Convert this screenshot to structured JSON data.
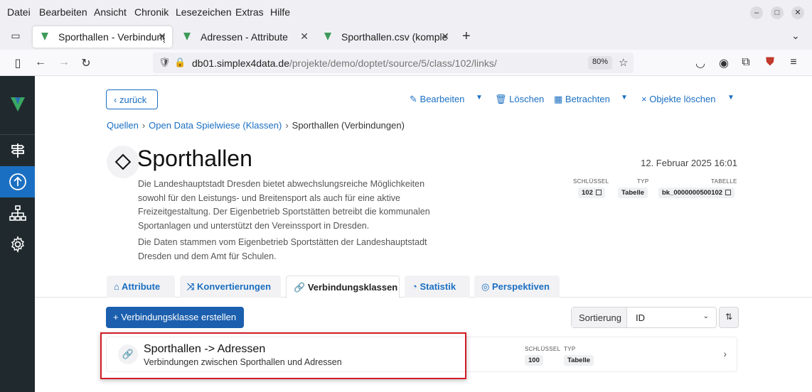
{
  "browser": {
    "menu": [
      "Datei",
      "Bearbeiten",
      "Ansicht",
      "Chronik",
      "Lesezeichen",
      "Extras",
      "Hilfe"
    ],
    "tabs": [
      {
        "label": "Sporthallen - Verbindungsklassen",
        "active": true
      },
      {
        "label": "Adressen - Attribute",
        "active": false
      },
      {
        "label": "Sporthallen.csv (komplett)",
        "active": false
      }
    ],
    "url_domain": "db01.simplex4data.de",
    "url_path": "/projekte/demo/doptet/source/5/class/102/links/",
    "zoom": "80%",
    "favicon_color": "#3d9a5a"
  },
  "sidebar": {
    "items": [
      "routing-icon",
      "upload-icon",
      "sitemap-icon",
      "gear-icon"
    ],
    "active_index": 1,
    "accent": "#1b6fc2"
  },
  "toolbar": {
    "back_label": "zurück",
    "edit_label": "Bearbeiten",
    "delete_label": "Löschen",
    "view_label": "Betrachten",
    "delete_objects_label": "Objekte löschen"
  },
  "breadcrumb": [
    "Quellen",
    "Open Data Spielwiese (Klassen)",
    "Sporthallen (Verbindungen)"
  ],
  "header": {
    "title": "Sporthallen",
    "datetime": "12. Februar 2025 16:01",
    "description_1": "Die Landeshauptstadt Dresden bietet abwechslungsreiche Möglichkeiten sowohl für den Leistungs- und Breitensport als auch für eine aktive Freizeitgestaltung. Der Eigenbetrieb Sportstätten betreibt die kommunalen Sportanlagen und unterstützt den Vereinssport in Dresden.",
    "description_2": "Die Daten stammen vom Eigenbetrieb Sportstätten der Landeshauptstadt Dresden und dem Amt für Schulen.",
    "meta": {
      "key_label": "SCHLÜSSEL",
      "key_value": "102",
      "type_label": "TYP",
      "type_value": "Tabelle",
      "table_label": "TABELLE",
      "table_value": "bk_0000000500102"
    }
  },
  "content_tabs": [
    {
      "label": "Attribute",
      "active": false
    },
    {
      "label": "Konvertierungen",
      "active": false
    },
    {
      "label": "Verbindungsklassen",
      "active": true
    },
    {
      "label": "Statistik",
      "active": false
    },
    {
      "label": "Perspektiven",
      "active": false
    }
  ],
  "list_controls": {
    "create_label": "Verbindungsklasse erstellen",
    "sort_label": "Sortierung",
    "sort_value": "ID"
  },
  "items": [
    {
      "title": "Sporthallen -> Adressen",
      "subtitle": "Verbindungen zwischen Sporthallen und Adressen",
      "key_label": "SCHLÜSSEL",
      "key_value": "100",
      "type_label": "TYP",
      "type_value": "Tabelle"
    }
  ],
  "colors": {
    "primary": "#1b6fc2",
    "primary_dark": "#1b5fae",
    "sidebar_bg": "#202a2e",
    "highlight_red": "#d01c24"
  }
}
